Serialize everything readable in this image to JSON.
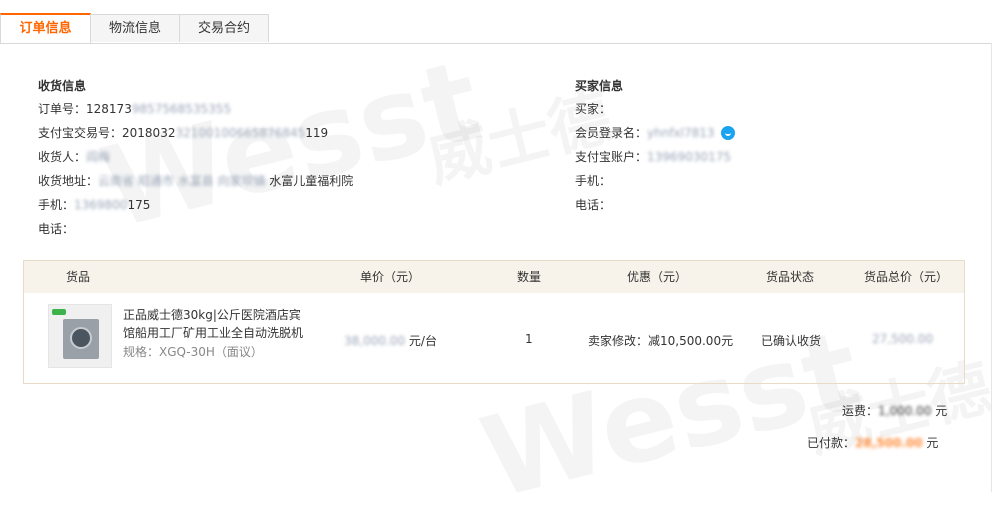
{
  "tabs": [
    {
      "label": "订单信息",
      "active": true
    },
    {
      "label": "物流信息",
      "active": false
    },
    {
      "label": "交易合约",
      "active": false
    }
  ],
  "receiver": {
    "title": "收货信息",
    "order_no_label": "订单号：",
    "order_no_visible": "128173",
    "order_no_masked": "9857568535355",
    "alipay_trade_label": "支付宝交易号：",
    "alipay_trade_visible": "2018032",
    "alipay_trade_masked": "32100100665876845",
    "alipay_trade_tail": "119",
    "name_label": "收货人：",
    "name_masked": "阎梅",
    "address_label": "收货地址：",
    "address_masked": "云南省 昭通市 水富县 向家坝镇",
    "address_visible": "水富儿童福利院",
    "phone_label": "手机：",
    "phone_masked": "1369800",
    "phone_tail": "175",
    "tel_label": "电话："
  },
  "buyer": {
    "title": "买家信息",
    "buyer_label": "买家：",
    "member_label": "会员登录名：",
    "member_masked": "yhnfxl7813",
    "alipay_label": "支付宝账户：",
    "alipay_masked": "13969030175",
    "mobile_label": "手机：",
    "tel_label": "电话："
  },
  "table": {
    "headers": [
      "货品",
      "单价（元）",
      "数量",
      "优惠（元）",
      "货品状态",
      "货品总价（元）"
    ],
    "rows": [
      {
        "title_line1": "正品威士德30kg|公斤医院酒店宾",
        "title_line2": "馆船用工厂矿用工业全自动洗脱机",
        "spec": "规格：XGQ-30H（面议）",
        "price_masked": "38,000.00",
        "price_unit": "元/台",
        "qty": "1",
        "discount": "卖家修改：减10,500.00元",
        "status": "已确认收货",
        "total_masked": "27,500.00"
      }
    ]
  },
  "summary": {
    "shipping_label": "运费：",
    "shipping_masked": "1,000.00",
    "shipping_unit": "元",
    "paid_label": "已付款：",
    "paid_masked": "28,500.00",
    "paid_unit": "元"
  },
  "watermark": {
    "text1": "Wesst",
    "text2": "威士德"
  }
}
